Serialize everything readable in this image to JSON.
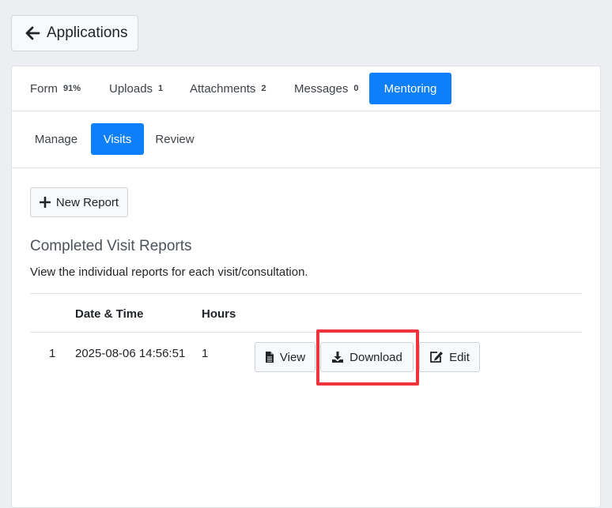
{
  "back_button": {
    "label": "Applications",
    "icon": "arrow-left-icon"
  },
  "tabs": [
    {
      "label": "Form",
      "badge": "91%",
      "active": false
    },
    {
      "label": "Uploads",
      "badge": "1",
      "active": false
    },
    {
      "label": "Attachments",
      "badge": "2",
      "active": false
    },
    {
      "label": "Messages",
      "badge": "0",
      "active": false
    },
    {
      "label": "Mentoring",
      "badge": "",
      "active": true
    }
  ],
  "subtabs": [
    {
      "label": "Manage",
      "active": false
    },
    {
      "label": "Visits",
      "active": true
    },
    {
      "label": "Review",
      "active": false
    }
  ],
  "new_report": {
    "label": "New Report",
    "icon": "plus-icon"
  },
  "section": {
    "title": "Completed Visit Reports",
    "description": "View the individual reports for each visit/consultation."
  },
  "table": {
    "headers": [
      "",
      "Date & Time",
      "Hours",
      ""
    ],
    "rows": [
      {
        "num": "1",
        "datetime": "2025-08-06 14:56:51",
        "hours": "1",
        "actions": [
          {
            "label": "View",
            "icon": "file-icon"
          },
          {
            "label": "Download",
            "icon": "download-icon"
          },
          {
            "label": "Edit",
            "icon": "edit-icon"
          }
        ]
      }
    ]
  },
  "colors": {
    "active_tab": "#0d7ffb",
    "highlight": "#f0343c",
    "background": "#eceef1"
  }
}
